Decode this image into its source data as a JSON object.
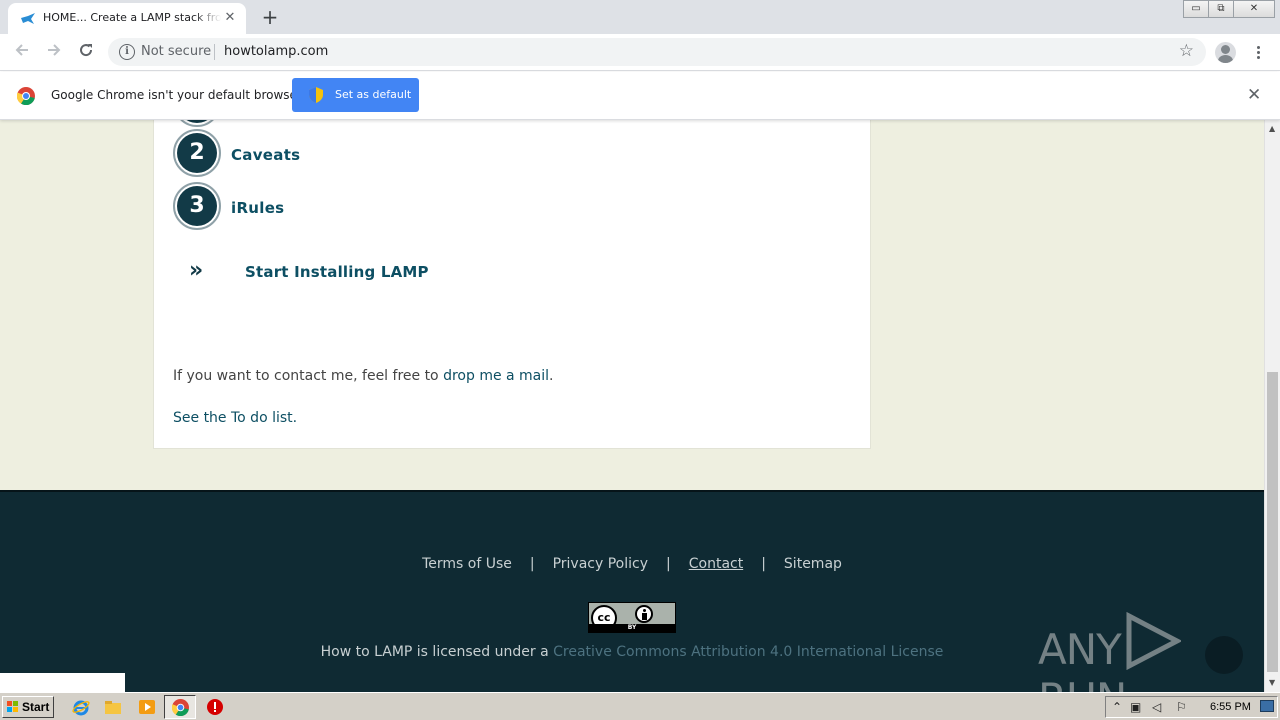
{
  "browser": {
    "tab_title": "HOME... Create a LAMP stack from scratch",
    "new_tab": "+",
    "tab_close": "✕",
    "window_controls": {
      "minimize": "▭",
      "restore": "⧉",
      "close": "✕"
    },
    "security_label": "Not secure",
    "url": "howtolamp.com",
    "info_icon": "i"
  },
  "infobar": {
    "message": "Google Chrome isn't your default browser",
    "button_label": "Set as default",
    "close": "✕",
    "button_color": "#4285f4"
  },
  "page": {
    "steps": [
      {
        "number": "2",
        "label": "Caveats"
      },
      {
        "number": "3",
        "label": "iRules"
      }
    ],
    "start_link": "Start Installing LAMP",
    "chevron": "»",
    "contact_prefix": "If you want to contact me, feel free to",
    "contact_link": "drop me a mail",
    "contact_suffix": ".",
    "todo_text": "See the To do list.",
    "accent_color": "#0d4f63",
    "background_color": "#eeefe0"
  },
  "footer": {
    "links": [
      "Terms of Use",
      "Privacy Policy",
      "Contact",
      "Sitemap"
    ],
    "separator": "|",
    "cc_badge": {
      "cc": "cc",
      "by": "BY"
    },
    "license_prefix": "How to LAMP is licensed under a",
    "license_link": "Creative Commons Attribution 4.0 International License",
    "background_color": "#0f2a33"
  },
  "watermark": {
    "left": "ANY",
    "right": "RUN"
  },
  "taskbar": {
    "start_label": "Start",
    "clock": "6:55 PM"
  }
}
